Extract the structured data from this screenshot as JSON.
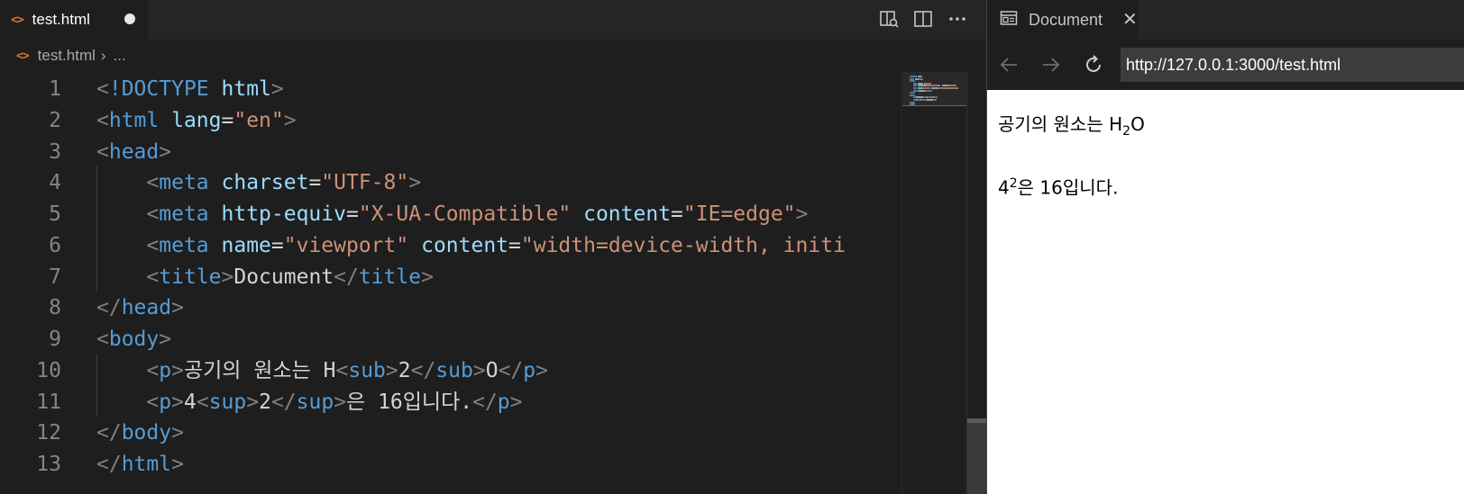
{
  "editor": {
    "tab": {
      "label": "test.html",
      "icon": "html-file-icon",
      "dirty": true
    },
    "actions": [
      "open-preview-icon",
      "split-editor-icon",
      "more-actions-icon"
    ],
    "breadcrumb": {
      "file": "test.html",
      "more": "..."
    },
    "lines": [
      {
        "n": "1",
        "tokens": [
          [
            "pt",
            "<"
          ],
          [
            "tg",
            "!DOCTYPE"
          ],
          [
            "tx",
            " "
          ],
          [
            "at",
            "html"
          ],
          [
            "pt",
            ">"
          ]
        ]
      },
      {
        "n": "2",
        "tokens": [
          [
            "pt",
            "<"
          ],
          [
            "tg",
            "html"
          ],
          [
            "tx",
            " "
          ],
          [
            "at",
            "lang"
          ],
          [
            "tx",
            "="
          ],
          [
            "st",
            "\"en\""
          ],
          [
            "pt",
            ">"
          ]
        ]
      },
      {
        "n": "3",
        "tokens": [
          [
            "pt",
            "<"
          ],
          [
            "tg",
            "head"
          ],
          [
            "pt",
            ">"
          ]
        ]
      },
      {
        "n": "4",
        "tokens": [
          [
            "tx",
            "    "
          ],
          [
            "pt",
            "<"
          ],
          [
            "tg",
            "meta"
          ],
          [
            "tx",
            " "
          ],
          [
            "at",
            "charset"
          ],
          [
            "tx",
            "="
          ],
          [
            "st",
            "\"UTF-8\""
          ],
          [
            "pt",
            ">"
          ]
        ]
      },
      {
        "n": "5",
        "tokens": [
          [
            "tx",
            "    "
          ],
          [
            "pt",
            "<"
          ],
          [
            "tg",
            "meta"
          ],
          [
            "tx",
            " "
          ],
          [
            "at",
            "http-equiv"
          ],
          [
            "tx",
            "="
          ],
          [
            "st",
            "\"X-UA-Compatible\""
          ],
          [
            "tx",
            " "
          ],
          [
            "at",
            "content"
          ],
          [
            "tx",
            "="
          ],
          [
            "st",
            "\"IE=edge\""
          ],
          [
            "pt",
            ">"
          ]
        ]
      },
      {
        "n": "6",
        "tokens": [
          [
            "tx",
            "    "
          ],
          [
            "pt",
            "<"
          ],
          [
            "tg",
            "meta"
          ],
          [
            "tx",
            " "
          ],
          [
            "at",
            "name"
          ],
          [
            "tx",
            "="
          ],
          [
            "st",
            "\"viewport\""
          ],
          [
            "tx",
            " "
          ],
          [
            "at",
            "content"
          ],
          [
            "tx",
            "="
          ],
          [
            "st",
            "\"width=device-width, initi"
          ]
        ]
      },
      {
        "n": "7",
        "tokens": [
          [
            "tx",
            "    "
          ],
          [
            "pt",
            "<"
          ],
          [
            "tg",
            "title"
          ],
          [
            "pt",
            ">"
          ],
          [
            "tx",
            "Document"
          ],
          [
            "pt",
            "</"
          ],
          [
            "tg",
            "title"
          ],
          [
            "pt",
            ">"
          ]
        ]
      },
      {
        "n": "8",
        "tokens": [
          [
            "pt",
            "</"
          ],
          [
            "tg",
            "head"
          ],
          [
            "pt",
            ">"
          ]
        ]
      },
      {
        "n": "9",
        "tokens": [
          [
            "pt",
            "<"
          ],
          [
            "tg",
            "body"
          ],
          [
            "pt",
            ">"
          ]
        ]
      },
      {
        "n": "10",
        "tokens": [
          [
            "tx",
            "    "
          ],
          [
            "pt",
            "<"
          ],
          [
            "tg",
            "p"
          ],
          [
            "pt",
            ">"
          ],
          [
            "tx",
            "공기의 원소는 H"
          ],
          [
            "pt",
            "<"
          ],
          [
            "tg",
            "sub"
          ],
          [
            "pt",
            ">"
          ],
          [
            "tx",
            "2"
          ],
          [
            "pt",
            "</"
          ],
          [
            "tg",
            "sub"
          ],
          [
            "pt",
            ">"
          ],
          [
            "tx",
            "O"
          ],
          [
            "pt",
            "</"
          ],
          [
            "tg",
            "p"
          ],
          [
            "pt",
            ">"
          ]
        ]
      },
      {
        "n": "11",
        "tokens": [
          [
            "tx",
            "    "
          ],
          [
            "pt",
            "<"
          ],
          [
            "tg",
            "p"
          ],
          [
            "pt",
            ">"
          ],
          [
            "tx",
            "4"
          ],
          [
            "pt",
            "<"
          ],
          [
            "tg",
            "sup"
          ],
          [
            "pt",
            ">"
          ],
          [
            "tx",
            "2"
          ],
          [
            "pt",
            "</"
          ],
          [
            "tg",
            "sup"
          ],
          [
            "pt",
            ">"
          ],
          [
            "tx",
            "은 16입니다."
          ],
          [
            "pt",
            "</"
          ],
          [
            "tg",
            "p"
          ],
          [
            "pt",
            ">"
          ]
        ]
      },
      {
        "n": "12",
        "tokens": [
          [
            "pt",
            "</"
          ],
          [
            "tg",
            "body"
          ],
          [
            "pt",
            ">"
          ]
        ]
      },
      {
        "n": "13",
        "tokens": [
          [
            "pt",
            "</"
          ],
          [
            "tg",
            "html"
          ],
          [
            "pt",
            ">"
          ]
        ]
      }
    ]
  },
  "browser": {
    "tab": {
      "label": "Document",
      "icon": "preview-page-icon",
      "close": "✕"
    },
    "url": "http://127.0.0.1:3000/test.html",
    "nav": [
      "back-arrow-icon",
      "forward-arrow-icon",
      "reload-icon"
    ],
    "content": {
      "p1": {
        "before": "공기의 원소는 H",
        "sub": "2",
        "after": "O"
      },
      "p2": {
        "before": "4",
        "sup": "2",
        "after": "은 16입니다."
      }
    }
  },
  "colors": {
    "tag": "#569cd6",
    "attr": "#9cdcfe",
    "string": "#ce9178",
    "punct": "#808080",
    "text": "#d4d4d4",
    "html_icon": "#e37933"
  }
}
